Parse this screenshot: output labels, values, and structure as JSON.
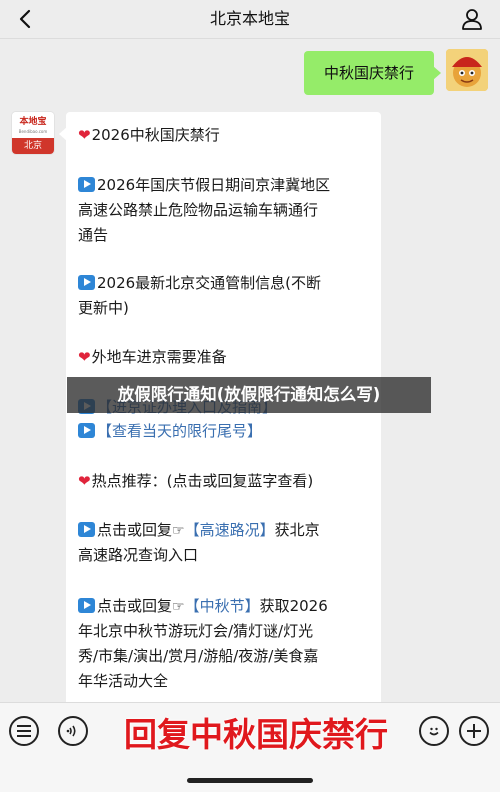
{
  "header": {
    "title": "北京本地宝"
  },
  "outgoing": {
    "text": "中秋国庆禁行"
  },
  "bot_avatar": {
    "logo": "本地宝",
    "logo_sub": "Bendibao.com",
    "city": "北京"
  },
  "message": {
    "heading": "2026中秋国庆禁行",
    "item1_line1": "2026年国庆节假日期间京津冀地区",
    "item1_line2": "高速公路禁止危险物品运输车辆通行",
    "item1_line3": "通告",
    "item2_line1": "2026最新北京交通管制信息(不断",
    "item2_line2": "更新中)",
    "section2_heading": "外地车进京需要准备",
    "item3": "【进京证办理入口及指南】",
    "item4": "【查看当天的限行尾号】",
    "hot_heading": "热点推荐：(点击或回复蓝字查看)",
    "hot1_prefix": "点击或回复",
    "hot1_link": "【高速路况】",
    "hot1_suffix": "获北京",
    "hot1_line2": "高速路况查询入口",
    "hot2_prefix": "点击或回复",
    "hot2_link": "【中秋节】",
    "hot2_suffix": "获取2026",
    "hot2_line2": "年北京中秋节游玩灯会/猜灯谜/灯光",
    "hot2_line3": "秀/市集/演出/赏月/游船/夜游/美食嘉",
    "hot2_line4": "年华活动大全"
  },
  "overlay": {
    "title": "放假限行通知(放假限行通知怎么写)"
  },
  "bottom": {
    "big_reply": "回复中秋国庆禁行"
  },
  "icons": {
    "back": "chevron-left-icon",
    "profile": "person-icon",
    "menu": "list-icon",
    "voice": "voice-icon",
    "emoji": "emoji-icon",
    "add": "plus-icon",
    "hand": "pointing-hand-icon"
  },
  "colors": {
    "outgoing_bubble": "#95ec69",
    "link": "#3a6fb0",
    "heart": "#e0243b",
    "play_badge": "#2e86d6",
    "big_reply": "#e0181d"
  }
}
